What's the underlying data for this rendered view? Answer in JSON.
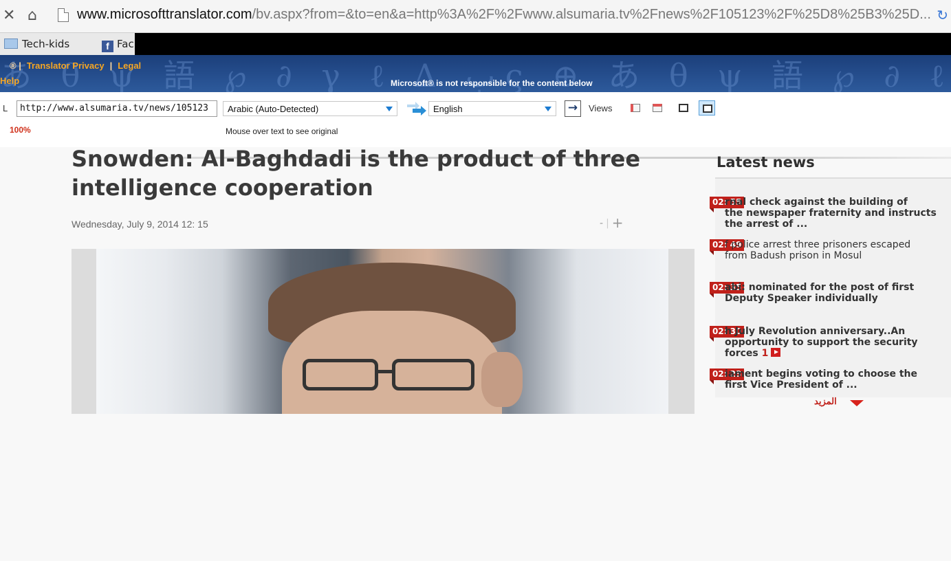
{
  "browser": {
    "url_host": "www.microsofttranslator.com",
    "url_path": "/bv.aspx?from=&to=en&a=http%3A%2F%2Fwww.alsumaria.tv%2Fnews%2F105123%2F%25D8%25B3%25D...",
    "bookmarks": [
      {
        "label": "Tech-kids",
        "icon": "folder-icon"
      },
      {
        "label": "Fac",
        "icon": "facebook-icon"
      }
    ]
  },
  "banner": {
    "link_translator_privacy": "Translator Privacy",
    "link_legal": "Legal",
    "link_help": "Help",
    "note": "Microsoft® is not responsible for the content below"
  },
  "toolbar": {
    "url_label": "L",
    "url_value": "http://www.alsumaria.tv/news/105123",
    "zoom": "100%",
    "from_language": "Arabic (Auto-Detected)",
    "to_language": "English",
    "views_label": "Views",
    "mouse_hint": "Mouse over text to see original"
  },
  "article": {
    "headline": "Snowden: Al-Baghdadi is the product of three intelligence cooperation",
    "date": "Wednesday, July 9, 2014 12: 15",
    "font_minus": "-",
    "font_plus": "+"
  },
  "latest": {
    "title": "Latest news",
    "items": [
      {
        "time": "02: 55",
        "text": "rnal check against the building of\nthe newspaper fraternity and instructs\nthe arrest of ...",
        "bold": true
      },
      {
        "time": "02: 49",
        "text": "f police arrest three prisoners escaped\nfrom Badush prison in Mosul",
        "bold": false
      },
      {
        "time": "02: 35",
        "text": "abi: nominated for the post of first\nDeputy Speaker individually",
        "bold": true
      },
      {
        "time": "02: 30",
        "text": "h July Revolution anniversary..An\nopportunity to support the security\nforces",
        "count": "1",
        "bold": true
      },
      {
        "time": "02: 23",
        "text": "iament begins voting to choose the\nfirst Vice President of ...",
        "bold": true
      }
    ],
    "more": "المزيد"
  },
  "colors": {
    "accent_red": "#c0201a",
    "banner_blue": "#264f8f",
    "banner_link": "#f5a623"
  }
}
